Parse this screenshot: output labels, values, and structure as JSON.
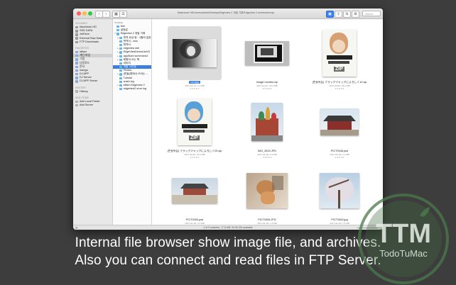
{
  "window": {
    "path": "Macintosh HD/Users/admin/Desktop/Edgeview 2 개발 기록/Edgeview 2 screenshot.zip",
    "search_placeholder": "Search"
  },
  "sidebar": {
    "sections": [
      {
        "title": "VOLUMES",
        "items": [
          "Macintosh HD",
          "SSD DATA",
          "JetDrive",
          "External Raw Data",
          "FTP Downloads"
        ]
      },
      {
        "title": "FAVORITES",
        "items": [
          "idfsen",
          "개인 파일",
          "그림",
          "다운로드",
          "문서",
          "manga",
          "DJ APP",
          "DJ Server",
          "DJ APP Server"
        ],
        "selected": 1
      },
      {
        "title": "HISTORY",
        "items": [
          "History"
        ]
      },
      {
        "title": "ADD ITEMS",
        "items": [
          "Add Local Folder",
          "Add Server"
        ]
      }
    ]
  },
  "tree": {
    "header": "Desktop",
    "items": [
      {
        "label": "test",
        "depth": 0,
        "arrow": ""
      },
      {
        "label": "설정값",
        "depth": 0,
        "arrow": ""
      },
      {
        "label": "Edgeview 2 개발 기록",
        "depth": 0,
        "arrow": "▾"
      },
      {
        "label": "번역 요금 등 - 1월의 일본",
        "depth": 1,
        "arrow": "▸"
      },
      {
        "label": "번역서 - new",
        "depth": 1,
        "arrow": ""
      },
      {
        "label": "번역서",
        "depth": 1,
        "arrow": ""
      },
      {
        "label": "edgeview site",
        "depth": 1,
        "arrow": "▸"
      },
      {
        "label": "EdgeViewDemoUseV2",
        "depth": 1,
        "arrow": "▸"
      },
      {
        "label": "appStore screenshot",
        "depth": 1,
        "arrow": "▸"
      },
      {
        "label": "회원이 쓰는 책",
        "depth": 1,
        "arrow": "▸"
      },
      {
        "label": "이미지",
        "depth": 1,
        "arrow": ""
      },
      {
        "label": "개발 사진첩",
        "depth": 1,
        "arrow": "",
        "selected": true
      },
      {
        "label": "Photos",
        "depth": 1,
        "arrow": ""
      },
      {
        "label": "(번들)앱에서 쓰이는 ...",
        "depth": 1,
        "arrow": "▸"
      },
      {
        "label": "Tutorial",
        "depth": 1,
        "arrow": ""
      },
      {
        "label": "crash log",
        "depth": 1,
        "arrow": ""
      },
      {
        "label": "idfsen Edgeview 2",
        "depth": 1,
        "arrow": "▸"
      },
      {
        "label": "edgeview2 error log",
        "depth": 1,
        "arrow": ""
      }
    ]
  },
  "files": [
    {
      "name": "rou.jpg",
      "meta": "2017-03-12 / 1.1 MB",
      "stars": "★★★★★",
      "selected": true,
      "kind": "portrait"
    },
    {
      "name": "image monitor.zip",
      "meta": "2017-03-12 / 10.4 MB",
      "stars": "★★★★★",
      "kind": "monitor"
    },
    {
      "name": "(번들특집) ブラックジャックによろしく10.zip",
      "meta": "2017-03-09 / 28.1 MB",
      "stars": "★★★★★",
      "kind": "manga2"
    },
    {
      "name": "(번들특집) ブラックジャックによろしく09.zip",
      "meta": "2017-03-09 / 30.2 MB",
      "stars": "★★★★★",
      "kind": "manga1"
    },
    {
      "name": "IMG_0515.JPG",
      "meta": "2017-02-18 / 3.4 MB",
      "stars": "★★★★★",
      "kind": "moscow"
    },
    {
      "name": "PICT0046.psd",
      "meta": "2017-02-18 / 2.1 MB",
      "stars": "★★★★★",
      "kind": "temple"
    },
    {
      "name": "PICT0053.psd",
      "meta": "2017-02-18 / 2.3 MB",
      "stars": "★★★★★",
      "kind": "palace"
    },
    {
      "name": "PICT0055.JPG",
      "meta": "2017-02-18 / 1.8 MB",
      "stars": "★★★★★",
      "kind": "cat"
    },
    {
      "name": "PICT0063.jpg",
      "meta": "2017-02-18 / 1.5 MB",
      "stars": "★★★★★",
      "kind": "tree"
    }
  ],
  "zip_label": "ZIP",
  "status": "1 of 9 selected, 17.8 MB, 99.06 GB available",
  "caption": {
    "line1": "Internal file browser show image file, and archives.",
    "line2": "Also you can connect and read files in FTP Server."
  },
  "logo": {
    "letters": "TTM",
    "name": "TodoTuMac",
    "color": "#4a7a4a"
  }
}
